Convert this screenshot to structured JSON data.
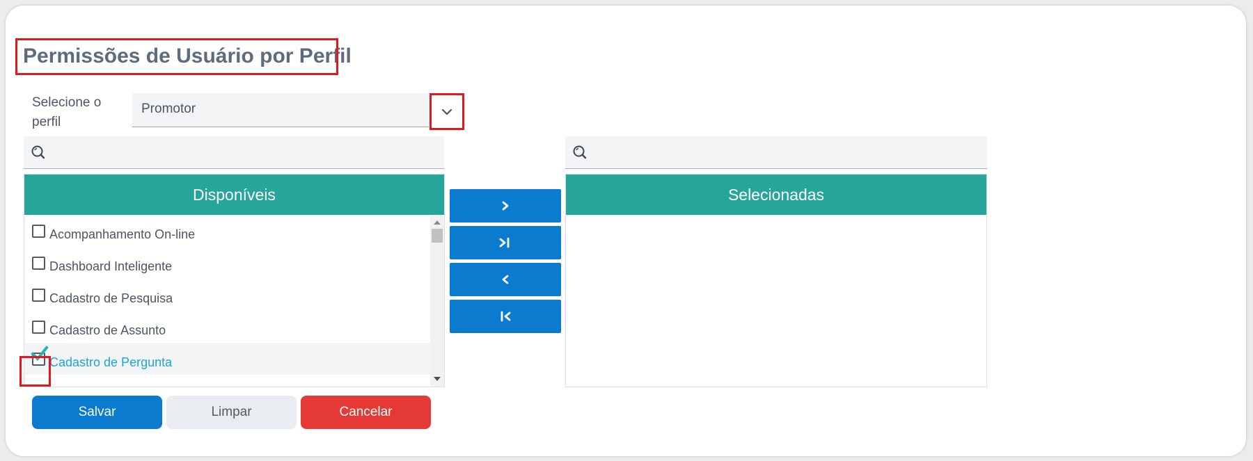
{
  "page": {
    "title": "Permissões de Usuário por Perfil"
  },
  "profile": {
    "label": "Selecione o perfil",
    "selected": "Promotor",
    "dropdown_icon": "chevron-down-icon"
  },
  "search": {
    "left_placeholder": "",
    "right_placeholder": "",
    "icon": "search-icon"
  },
  "available": {
    "header": "Disponíveis",
    "items": [
      {
        "label": "Acompanhamento On-line",
        "checked": false
      },
      {
        "label": "Dashboard Inteligente",
        "checked": false
      },
      {
        "label": "Cadastro de Pesquisa",
        "checked": false
      },
      {
        "label": "Cadastro de Assunto",
        "checked": false
      },
      {
        "label": "Cadastro de Pergunta",
        "checked": true
      }
    ]
  },
  "selected_list": {
    "header": "Selecionadas",
    "items": []
  },
  "transfer_buttons": [
    "move-right-icon",
    "move-all-right-icon",
    "move-left-icon",
    "move-all-left-icon"
  ],
  "actions": {
    "save": "Salvar",
    "clear": "Limpar",
    "cancel": "Cancelar"
  },
  "colors": {
    "accent_teal": "#26a69a",
    "primary_blue": "#0a7bcf",
    "danger_red": "#e53935",
    "highlight_red": "#e0191f"
  }
}
